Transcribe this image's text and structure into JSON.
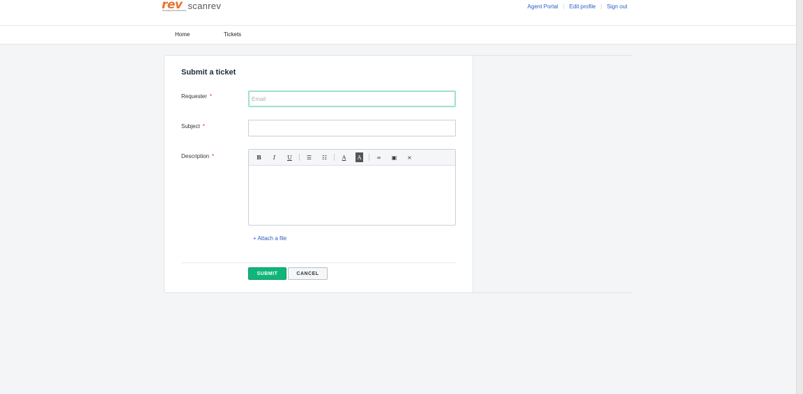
{
  "header": {
    "logo_mark": "rev",
    "logo_tagline": "Revealing Revolutionised",
    "logo_text": "scanrev",
    "links": [
      "Agent Portal",
      "Edit profile",
      "Sign out"
    ],
    "separator": "|"
  },
  "nav": {
    "items": [
      "Home",
      "Tickets"
    ]
  },
  "form": {
    "title": "Submit a ticket",
    "required_mark": "*",
    "requester": {
      "label": "Requester",
      "placeholder": "Email",
      "value": ""
    },
    "subject": {
      "label": "Subject",
      "value": ""
    },
    "description": {
      "label": "Description",
      "value": ""
    },
    "toolbar": {
      "bold": "B",
      "italic": "I",
      "underline": "U",
      "bullet_list": "☰",
      "numbered_list": "☷",
      "text_color": "A",
      "background_color": "A",
      "link": "∞",
      "image": "▣",
      "clear_format": "⨯"
    },
    "attach_label": "+ Attach a file",
    "submit_label": "SUBMIT",
    "cancel_label": "CANCEL"
  },
  "colors": {
    "brand_orange": "#e8702a",
    "link_blue": "#2c5cc5",
    "submit_green": "#10b57a",
    "focus_green": "#9ee2c6",
    "required_red": "#d72d30"
  }
}
